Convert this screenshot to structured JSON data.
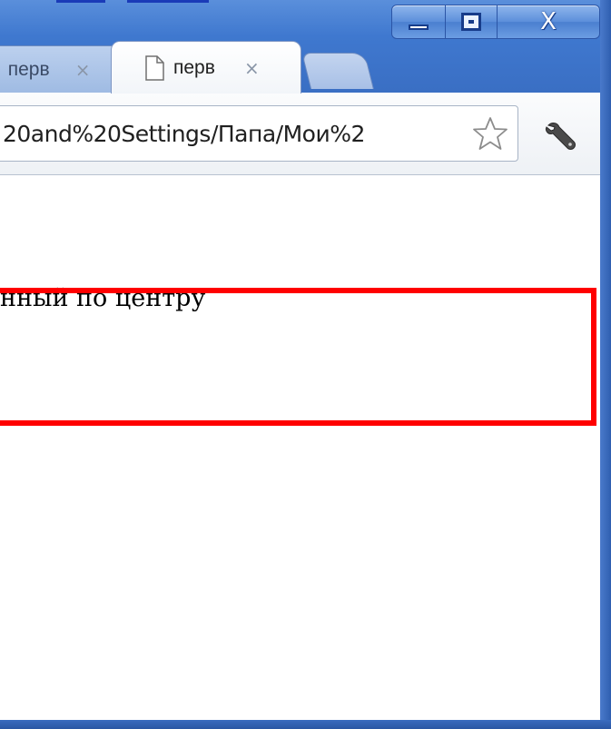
{
  "window": {
    "controls": {
      "minimize_label": "",
      "maximize_label": "",
      "close_label": "X"
    }
  },
  "tabs": [
    {
      "label": "перв",
      "close_label": "×",
      "active": false
    },
    {
      "label": "перв",
      "close_label": "×",
      "active": true
    }
  ],
  "toolbar": {
    "address": "20and%20Settings/Папа/Мои%2",
    "bookmark_icon": "star-icon",
    "menu_icon": "wrench-icon"
  },
  "content": {
    "text": "нный по центру",
    "box_border_color": "#ff0000"
  },
  "colors": {
    "frame_blue": "#3f78cf",
    "accent_red": "#ff0000"
  }
}
